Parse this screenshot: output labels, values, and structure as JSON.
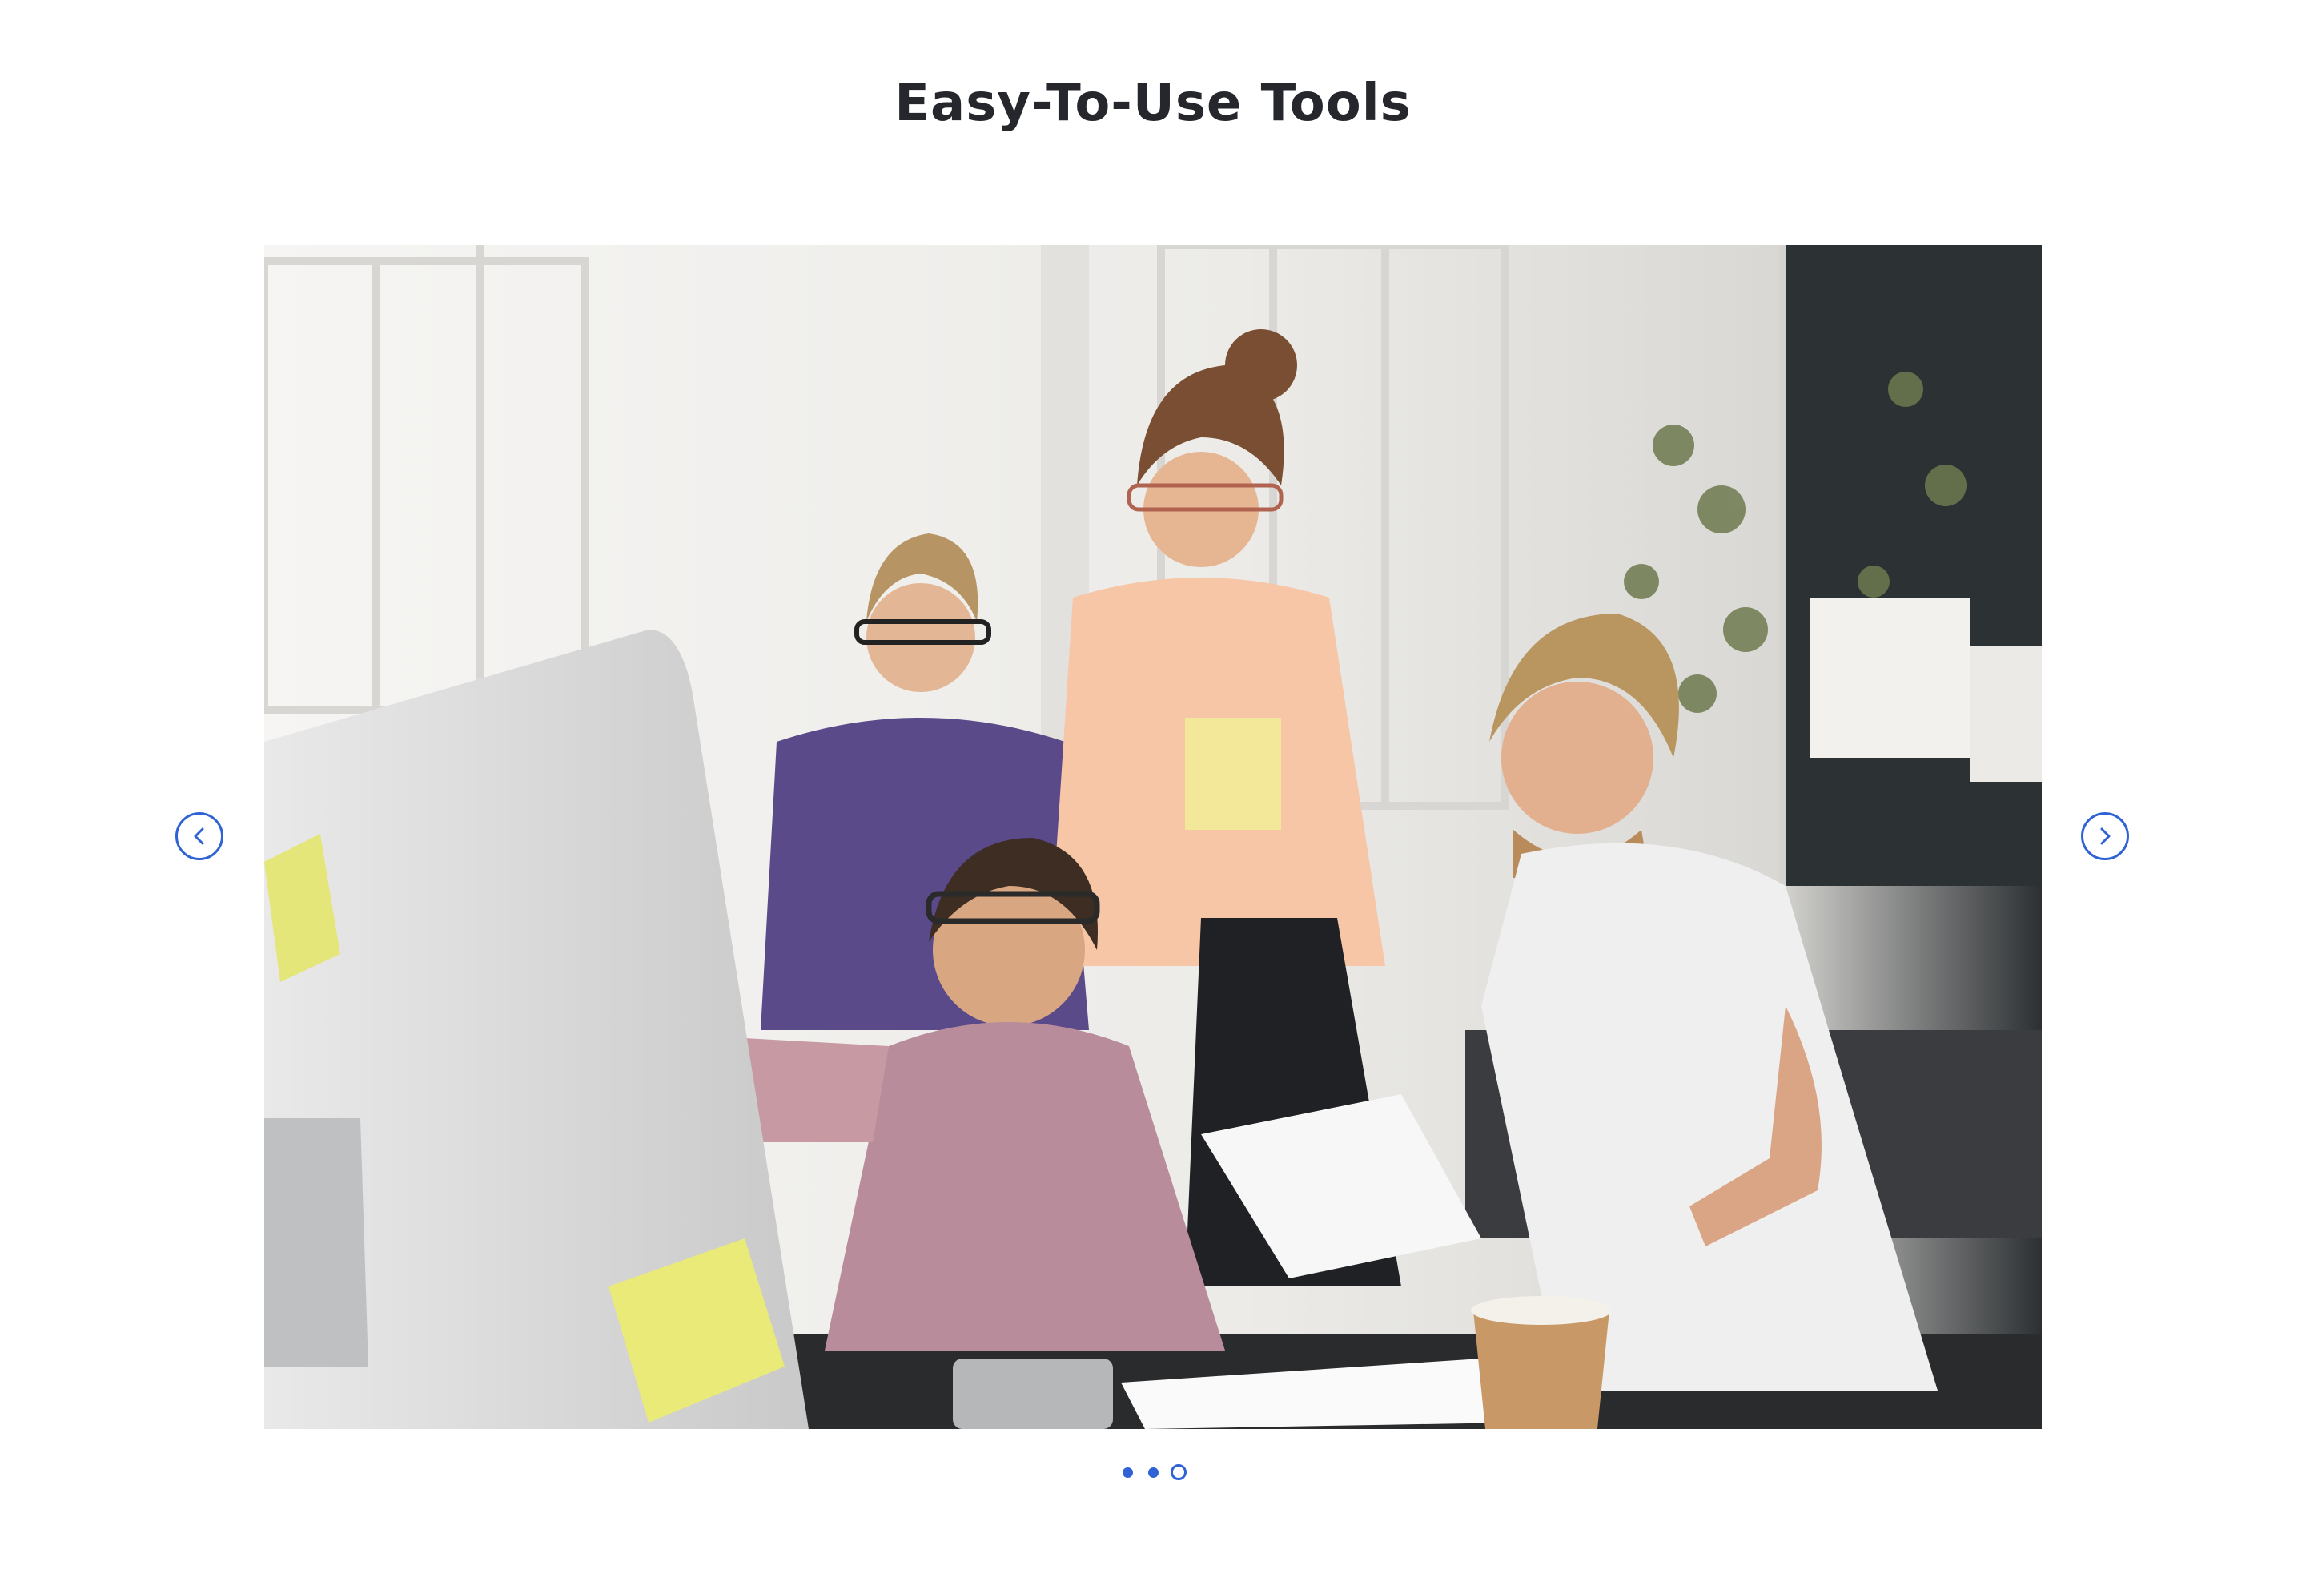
{
  "section": {
    "title": "Easy-To-Use Tools"
  },
  "slider": {
    "image_alt": "Team of four colleagues gathered around a desktop computer in a bright office",
    "prev_icon": "chevron-left-icon",
    "next_icon": "chevron-right-icon",
    "slide_count": 3,
    "active_slide": 3
  },
  "colors": {
    "accent": "#2f62d5",
    "title": "#25272d",
    "background": "#ffffff"
  }
}
